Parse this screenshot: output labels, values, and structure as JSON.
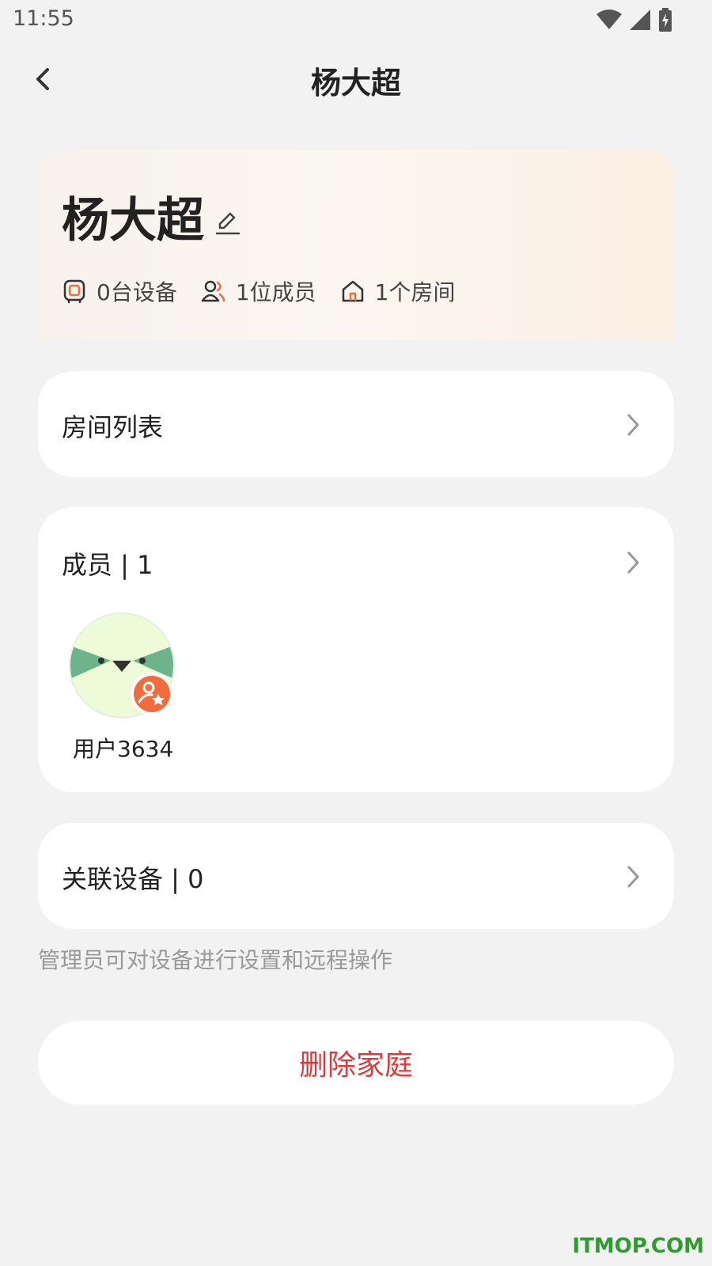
{
  "status": {
    "time": "11:55"
  },
  "header": {
    "title": "杨大超"
  },
  "family": {
    "name": "杨大超",
    "devices": "0台设备",
    "members": "1位成员",
    "rooms": "1个房间"
  },
  "rooms_card": {
    "label": "房间列表"
  },
  "members_card": {
    "label": "成员 | 1",
    "member_name": "用户3634"
  },
  "devices_card": {
    "label": "关联设备 | 0"
  },
  "hint": "管理员可对设备进行设置和远程操作",
  "delete_label": "删除家庭",
  "watermark": "ITMOP.COM",
  "colors": {
    "accent": "#f26b3a",
    "danger": "#e23a3a",
    "avatar_green": "#6db38b"
  },
  "icons": [
    "back-icon",
    "wifi-icon",
    "signal-icon",
    "battery-icon",
    "edit-icon",
    "device-icon",
    "members-icon",
    "home-icon",
    "chevron-right-icon",
    "admin-badge-icon"
  ]
}
